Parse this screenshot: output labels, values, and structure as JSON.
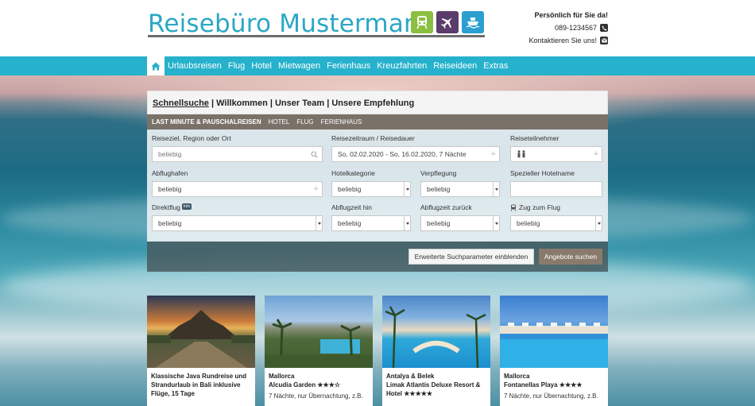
{
  "header": {
    "logo_text": "Reisebüro Mustermann",
    "icons": [
      "train-icon",
      "plane-icon",
      "ship-icon"
    ],
    "contact": {
      "tagline": "Persönlich für Sie da!",
      "phone": "089-1234567",
      "contact_link": "Kontaktieren Sie uns!"
    }
  },
  "nav": {
    "items": [
      "Urlaubsreisen",
      "Flug",
      "Hotel",
      "Mietwagen",
      "Ferienhaus",
      "Kreuzfahrten",
      "Reiseideen",
      "Extras"
    ]
  },
  "search": {
    "tabs": {
      "active": "Schnellsuche",
      "rest": " | Willkommen | Unser Team | Unsere Empfehlung"
    },
    "subtabs": [
      "LAST MINUTE & PAUSCHALREISEN",
      "HOTEL",
      "FLUG",
      "FERIENHAUS"
    ],
    "fields": {
      "destination_label": "Reiseziel, Region oder Ort",
      "destination_placeholder": "beliebig",
      "period_label": "Reisezeitraum / Reisedauer",
      "period_value": "So, 02.02.2020 - So, 16.02.2020, 7 Nächte",
      "travelers_label": "Reiseteilnehmer",
      "airport_label": "Abflughafen",
      "airport_value": "beliebig",
      "hotel_cat_label": "Hotelkategorie",
      "hotel_cat_value": "beliebig",
      "board_label": "Verpflegung",
      "board_value": "beliebig",
      "hotel_name_label": "Spezieller Hotelname",
      "hotel_name_value": "",
      "direct_label": "Direktflug",
      "direct_info": "Info",
      "direct_value": "beliebig",
      "out_label": "Abflugzeit hin",
      "out_value": "beliebig",
      "back_label": "Abflugzeit zurück",
      "back_value": "beliebig",
      "train_label": "Zug zum Flug",
      "train_value": "beliebig"
    },
    "buttons": {
      "advanced": "Erweiterte Suchparameter einblenden",
      "submit": "Angebote suchen"
    }
  },
  "cards": [
    {
      "title": "Klassische Java Rundreise und Strandurlaub in Bali inklusive Flüge, 15 Tage",
      "desc": ""
    },
    {
      "title": "Mallorca",
      "subtitle": "Alcudia Garden ★★★☆",
      "desc": "7 Nächte, nur Übernachtung, z.B."
    },
    {
      "title": "Antalya & Belek",
      "subtitle": "Limak Atlantis Deluxe Resort & Hotel ★★★★★",
      "desc": ""
    },
    {
      "title": "Mallorca",
      "subtitle": "Fontanellas Playa ★★★★",
      "desc": "7 Nächte, nur Übernachtung, z.B."
    }
  ],
  "colors": {
    "brand": "#2aa8c4",
    "nav": "#26b1cc",
    "subtabs": "#7a7168",
    "submit": "#8a7a6c"
  }
}
